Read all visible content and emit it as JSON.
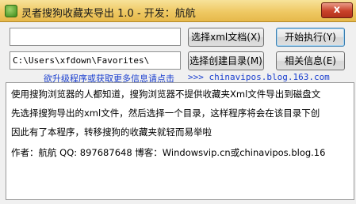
{
  "window": {
    "title": "灵者搜狗收藏夹导出 1.0 - 开发：航航",
    "close_glyph": "x"
  },
  "xml_input": {
    "value": ""
  },
  "path_input": {
    "value": "C:\\Users\\xfdown\\Favorites\\"
  },
  "buttons": {
    "select_xml": "选择xml文档(X)",
    "start": "开始执行(Y)",
    "select_dir": "选择创建目录(M)",
    "about": "相关信息(E)"
  },
  "link_row": {
    "text": "欲升级程序或获取更多信息请点击",
    "url": ">>> chinavipos.blog.163.com"
  },
  "info": {
    "line1": "使用搜狗浏览器的人都知道，搜狗浏览器不提供收藏夹Xml文件导出到磁盘文",
    "line2": "先选择搜狗导出的xml文件，然后选择一个目录，这样程序将会在该目录下创",
    "line3": "因此有了本程序，转移搜狗的收藏夹就轻而易举啦",
    "line4": "作者：航航    QQ: 897687648    博客：Windowsvip.cn或chinavipos.blog.16"
  },
  "colors": {
    "link": "#1a3fcf",
    "title_bar": "#efc964",
    "close": "#c9422a"
  }
}
